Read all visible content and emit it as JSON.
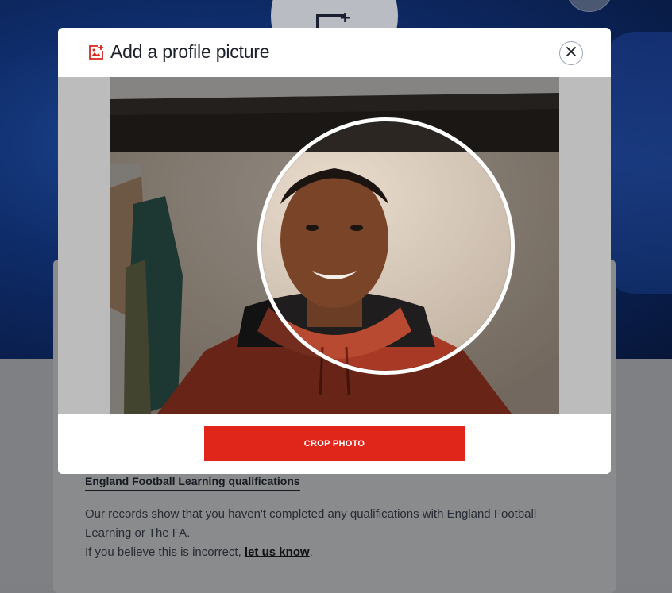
{
  "modal": {
    "title": "Add a profile picture",
    "title_icon": "image-add-icon",
    "close_icon": "close-icon",
    "crop_button_label": "CROP PHOTO",
    "accent_color": "#e0261b"
  },
  "background_page": {
    "qualifications_heading": "England Football Learning qualifications",
    "qualifications_text": "Our records show that you haven't completed any qualifications with England Football Learning or The FA.",
    "incorrect_prefix": "If you believe this is incorrect, ",
    "incorrect_link": "let us know",
    "incorrect_suffix": "."
  }
}
